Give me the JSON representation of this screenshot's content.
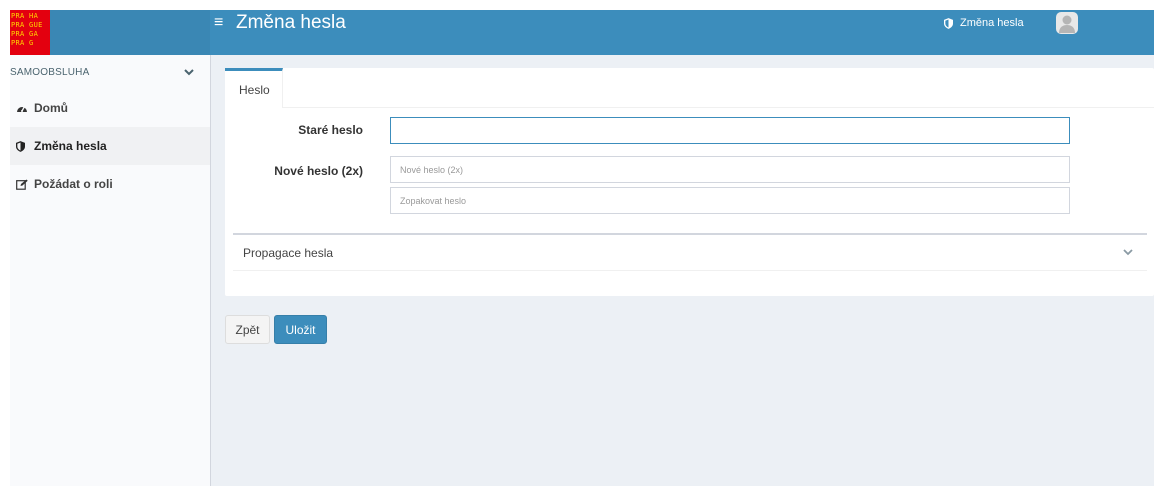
{
  "brand": {
    "logo_lines": [
      "PRA HA",
      "PRA GUE",
      "PRA GA",
      "PRA G"
    ],
    "colors": {
      "logo_bg": "#e3000f",
      "logo_text": "#ffd400",
      "header": "#3c8dbc"
    }
  },
  "header": {
    "menu_icon": "hamburger-icon",
    "title": "Změna hesla",
    "user_link": "Změna hesla",
    "user_icon": "shield-icon",
    "avatar_icon": "user-avatar-icon"
  },
  "sidebar": {
    "section_label": "SAMOOBSLUHA",
    "items": [
      {
        "label": "Domů",
        "icon": "tachometer-icon",
        "active": false
      },
      {
        "label": "Změna hesla",
        "icon": "shield-icon",
        "active": true
      },
      {
        "label": "Požádat o roli",
        "icon": "edit-icon",
        "active": false
      }
    ]
  },
  "main": {
    "tab_label": "Heslo",
    "old_password_label": "Staré heslo",
    "old_password_value": "",
    "new_password_label": "Nové heslo (2x)",
    "new_password_placeholder": "Nové heslo (2x)",
    "repeat_password_placeholder": "Zopakovat heslo",
    "propagation_title": "Propagace hesla",
    "back_label": "Zpět",
    "save_label": "Uložit"
  }
}
